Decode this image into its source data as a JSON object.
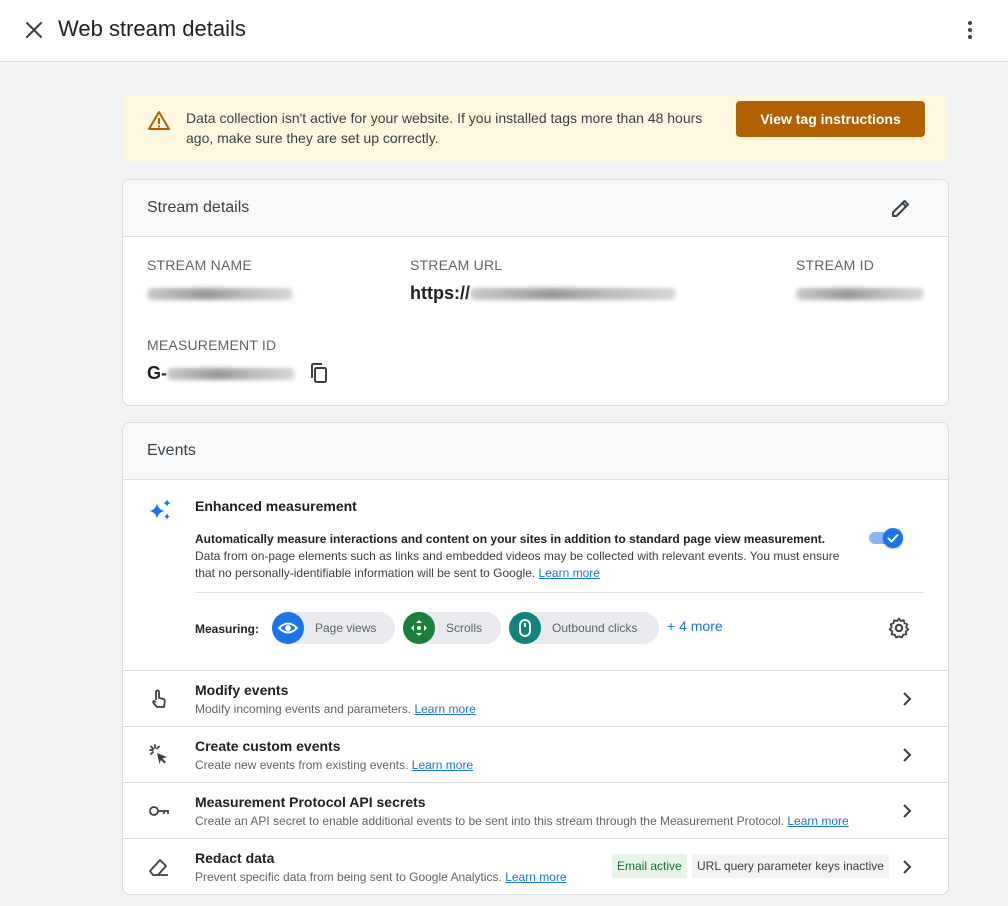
{
  "header": {
    "title": "Web stream details"
  },
  "banner": {
    "message": "Data collection isn't active for your website. If you installed tags more than 48 hours ago, make sure they are set up correctly.",
    "button_label": "View tag instructions"
  },
  "stream_details": {
    "title": "Stream details",
    "stream_name_label": "STREAM NAME",
    "stream_url_label": "STREAM URL",
    "stream_url_prefix": "https://",
    "stream_id_label": "STREAM ID",
    "measurement_id_label": "MEASUREMENT ID",
    "measurement_id_prefix": "G-"
  },
  "events": {
    "title": "Events",
    "enhanced_measurement": {
      "title": "Enhanced measurement",
      "desc_bold": "Automatically measure interactions and content on your sites in addition to standard page view measurement.",
      "desc_rest": "Data from on-page elements such as links and embedded videos may be collected with relevant events. You must ensure that no personally-identifiable information will be sent to Google.",
      "learn_more": "Learn more",
      "toggle_on": true,
      "measuring_label": "Measuring:",
      "chips": [
        {
          "label": "Page views",
          "icon": "eye-icon",
          "color": "#1a73e8"
        },
        {
          "label": "Scrolls",
          "icon": "scroll-icon",
          "color": "#188038"
        },
        {
          "label": "Outbound clicks",
          "icon": "mouse-icon",
          "color": "#12837a"
        }
      ],
      "more_label": "+ 4 more"
    },
    "rows": [
      {
        "title": "Modify events",
        "desc": "Modify incoming events and parameters.",
        "learn_more": "Learn more",
        "icon": "touch-icon"
      },
      {
        "title": "Create custom events",
        "desc": "Create new events from existing events.",
        "learn_more": "Learn more",
        "icon": "click-sparkle-icon"
      },
      {
        "title": "Measurement Protocol API secrets",
        "desc": "Create an API secret to enable additional events to be sent into this stream through the Measurement Protocol.",
        "learn_more": "Learn more",
        "icon": "key-icon"
      },
      {
        "title": "Redact data",
        "desc": "Prevent specific data from being sent to Google Analytics.",
        "learn_more": "Learn more",
        "icon": "eraser-icon",
        "badge_email": "Email active",
        "badge_url": "URL query parameter keys inactive"
      }
    ]
  },
  "colors": {
    "accent": "#1a73e8",
    "banner_bg": "#fef7e0",
    "banner_button": "#b06000",
    "email_badge_bg": "#e6f4ea",
    "email_badge_text": "#137333"
  }
}
